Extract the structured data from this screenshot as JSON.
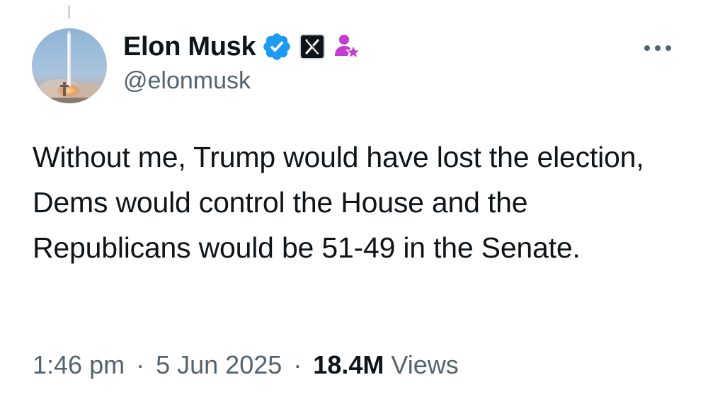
{
  "author": {
    "display_name": "Elon Musk",
    "handle": "@elonmusk",
    "badges": [
      "verified-badge-icon",
      "x-affiliate-badge-icon",
      "community-notes-contributor-icon"
    ]
  },
  "tweet": {
    "text": "Without me, Trump would have lost the election, Dems would control the House and the Republicans would be 51-49 in the Senate."
  },
  "meta": {
    "time": "1:46 pm",
    "separator": "·",
    "date": "5 Jun 2025",
    "views_count": "18.4M",
    "views_label": "Views"
  },
  "colors": {
    "verified_blue": "#1d9bf0",
    "secondary_text": "#536471",
    "primary_text": "#0f1419",
    "badge_magenta": "#c43bd0"
  },
  "icons": {
    "more": "more-options-icon"
  }
}
